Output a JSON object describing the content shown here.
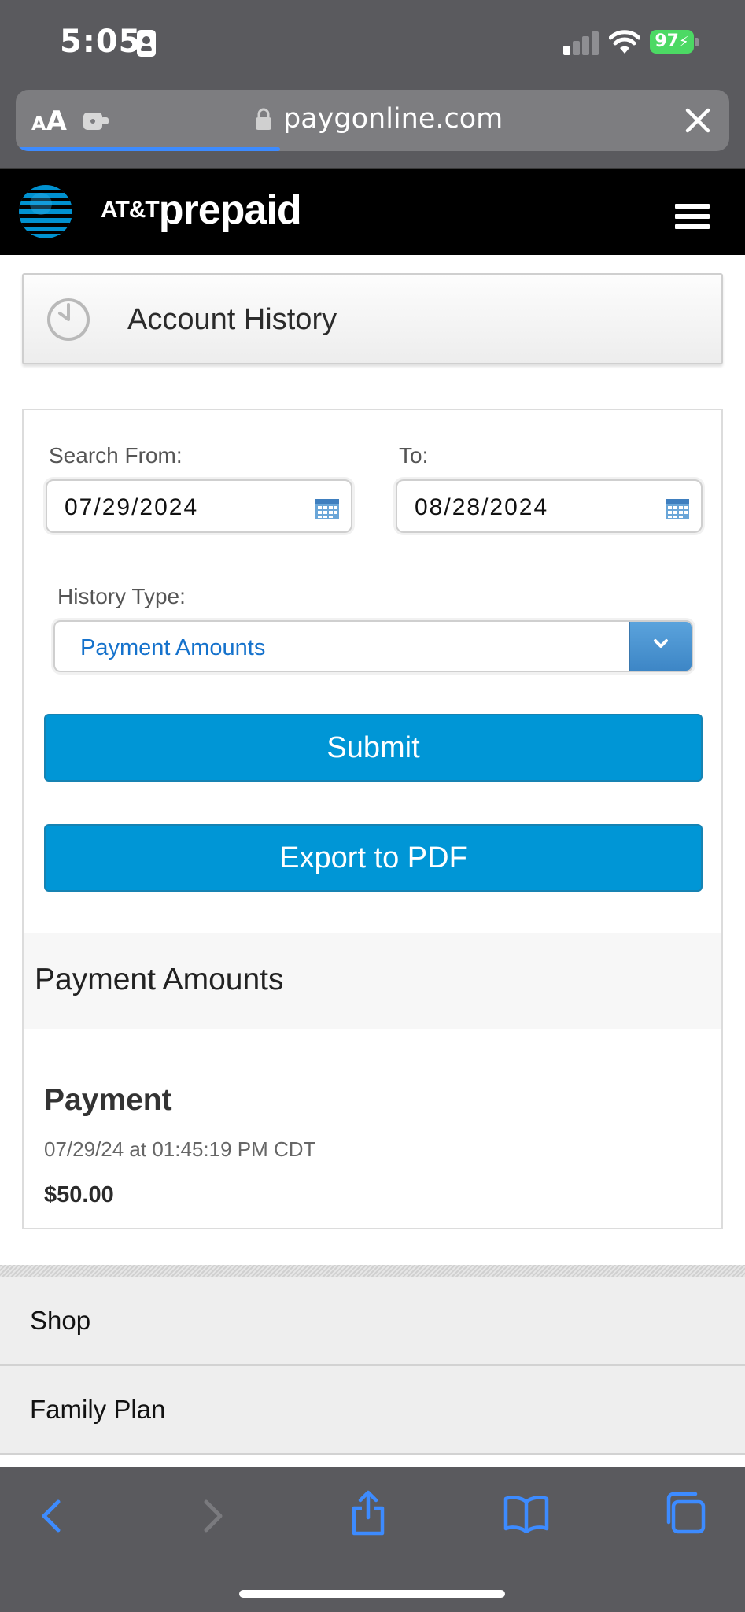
{
  "status_bar": {
    "time": "5:05",
    "battery": "97"
  },
  "browser": {
    "text_size_label": "AA",
    "url": "paygonline.com",
    "load_progress": 0.37,
    "icons": [
      "extension-icon",
      "lock-icon",
      "close-icon"
    ]
  },
  "site_header": {
    "brand_att": "AT&T",
    "brand_prepaid": "prepaid",
    "icons": [
      "att-globe-logo",
      "hamburger-menu-icon"
    ]
  },
  "page": {
    "title": "Account History",
    "title_icon": "clock-icon"
  },
  "form": {
    "search_from_label": "Search From:",
    "search_from_value": "07/29/2024",
    "to_label": "To:",
    "to_value": "08/28/2024",
    "history_type_label": "History Type:",
    "history_type_value": "Payment Amounts",
    "submit_label": "Submit",
    "export_label": "Export to PDF"
  },
  "results": {
    "heading": "Payment Amounts",
    "items": [
      {
        "type": "Payment",
        "datetime": "07/29/24 at 01:45:19 PM CDT",
        "amount": "$50.00"
      }
    ]
  },
  "footer_nav": {
    "items": [
      {
        "label": "Shop"
      },
      {
        "label": "Family Plan"
      }
    ]
  },
  "toolbar": {
    "icons": [
      "back-icon",
      "forward-icon",
      "share-icon",
      "bookmarks-icon",
      "tabs-icon"
    ]
  },
  "colors": {
    "accent_button": "#0096d6",
    "select_value": "#1572cc",
    "browser_chrome": "#5a5a5e",
    "battery": "#4cd964",
    "ios_link_blue": "#3d8bff"
  }
}
